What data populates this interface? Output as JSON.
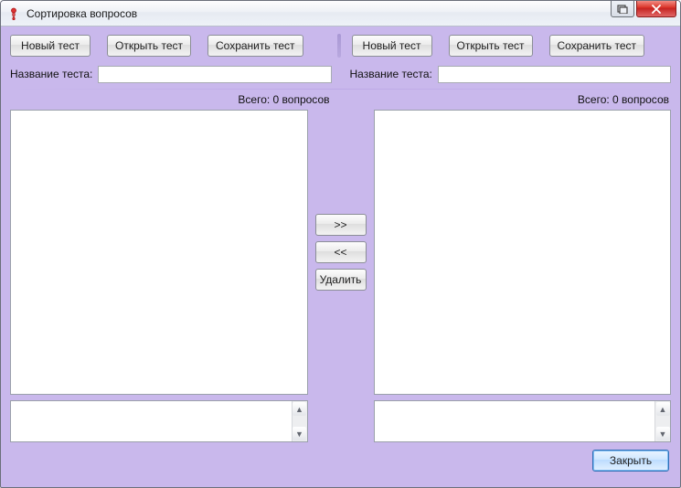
{
  "window": {
    "title": "Сортировка вопросов"
  },
  "toolbar": {
    "left": {
      "new": "Новый тест",
      "open": "Открыть тест",
      "save": "Сохранить тест"
    },
    "right": {
      "new": "Новый тест",
      "open": "Открыть тест",
      "save": "Сохранить тест"
    }
  },
  "labels": {
    "left_name": "Название теста:",
    "right_name": "Название теста:",
    "left_count": "Всего: 0 вопросов",
    "right_count": "Всего: 0 вопросов"
  },
  "inputs": {
    "left_name_value": "",
    "right_name_value": ""
  },
  "middle": {
    "move_right": ">>",
    "move_left": "<<",
    "delete": "Удалить"
  },
  "footer": {
    "close": "Закрыть"
  }
}
